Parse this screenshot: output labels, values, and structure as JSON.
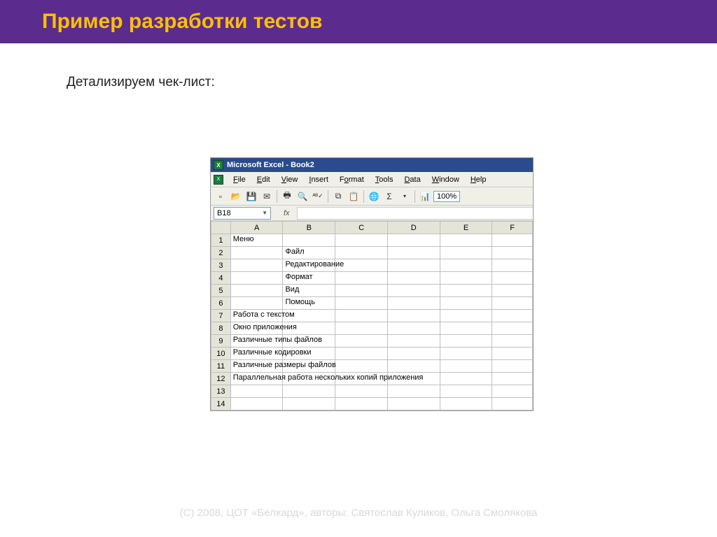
{
  "slide": {
    "title": "Пример разработки тестов",
    "subtitle": "Детализируем чек-лист:",
    "footer": "(С) 2008, ЦОТ «Белхард», авторы: Святослав Куликов, Ольга Смолякова"
  },
  "excel": {
    "titlebar": "Microsoft Excel - Book2",
    "menus": [
      "File",
      "Edit",
      "View",
      "Insert",
      "Format",
      "Tools",
      "Data",
      "Window",
      "Help"
    ],
    "zoom": "100%",
    "active_cell": "B18",
    "fx": "fx",
    "columns": [
      "A",
      "B",
      "C",
      "D",
      "E",
      "F"
    ],
    "rows": [
      {
        "n": "1",
        "A": "Меню",
        "B": ""
      },
      {
        "n": "2",
        "A": "",
        "B": "Файл"
      },
      {
        "n": "3",
        "A": "",
        "B": "Редактирование"
      },
      {
        "n": "4",
        "A": "",
        "B": "Формат"
      },
      {
        "n": "5",
        "A": "",
        "B": "Вид"
      },
      {
        "n": "6",
        "A": "",
        "B": "Помощь"
      },
      {
        "n": "7",
        "A": "Работа с текстом",
        "B": ""
      },
      {
        "n": "8",
        "A": "Окно приложения",
        "B": ""
      },
      {
        "n": "9",
        "A": "Различные типы файлов",
        "B": ""
      },
      {
        "n": "10",
        "A": "Различные кодировки",
        "B": ""
      },
      {
        "n": "11",
        "A": "Различные размеры файлов",
        "B": ""
      },
      {
        "n": "12",
        "A": "Параллельная работа нескольких копий приложения",
        "B": ""
      },
      {
        "n": "13",
        "A": "",
        "B": ""
      },
      {
        "n": "14",
        "A": "",
        "B": ""
      }
    ]
  }
}
